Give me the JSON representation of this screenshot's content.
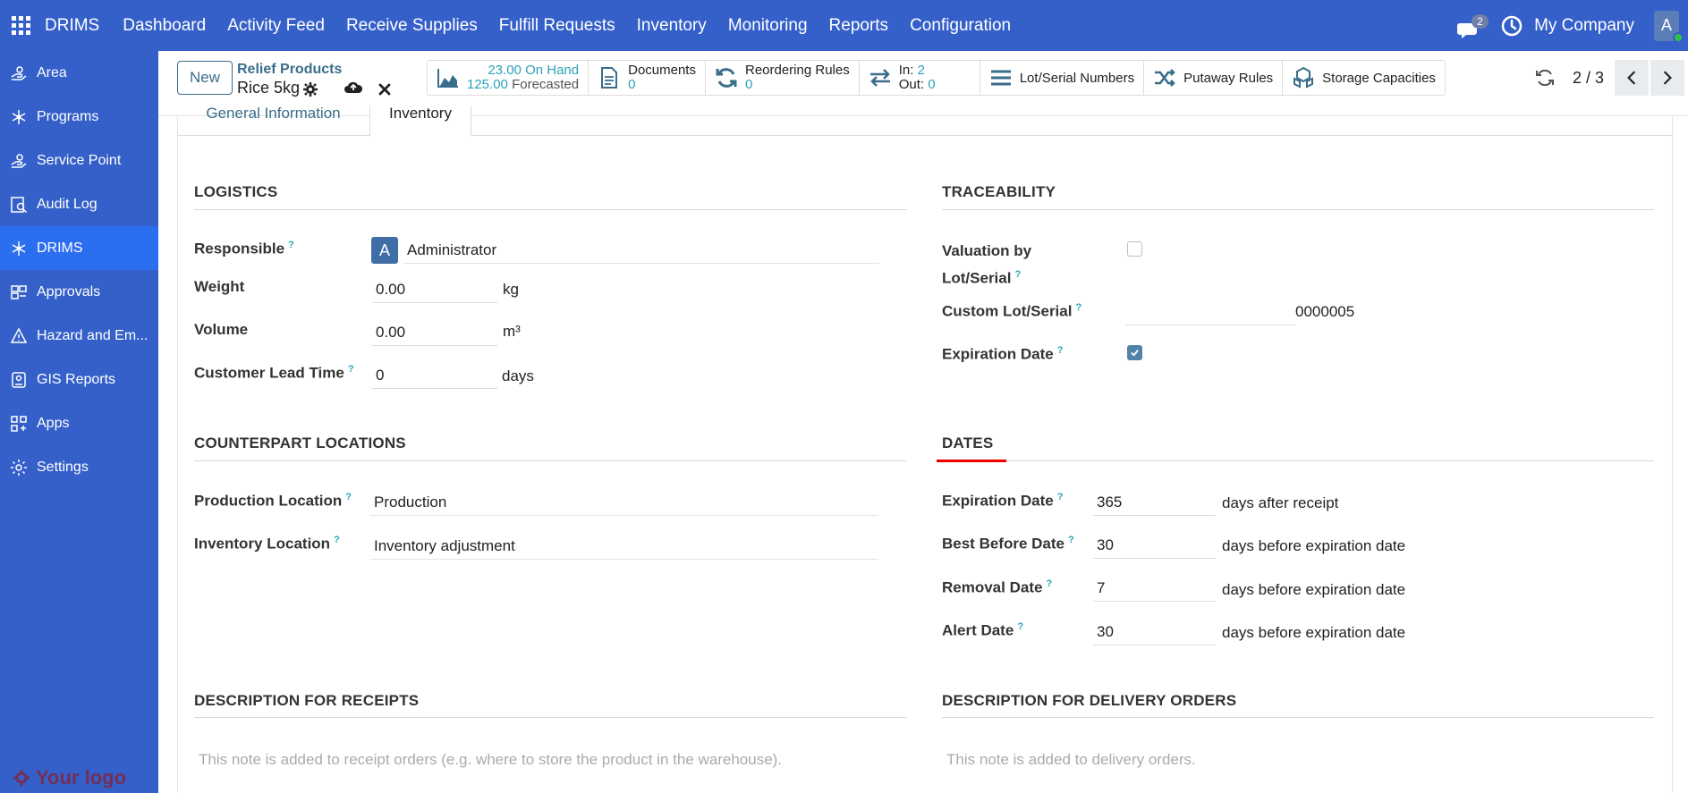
{
  "app": {
    "brand": "DRIMS",
    "menu": [
      "Dashboard",
      "Activity Feed",
      "Receive Supplies",
      "Fulfill Requests",
      "Inventory",
      "Monitoring",
      "Reports",
      "Configuration"
    ],
    "chat_count": "2",
    "company": "My Company",
    "user_initial": "A"
  },
  "sidebar": {
    "items": [
      {
        "label": "Area",
        "icon": "hand-icon"
      },
      {
        "label": "Programs",
        "icon": "network-icon"
      },
      {
        "label": "Service Point",
        "icon": "hand-icon"
      },
      {
        "label": "Audit Log",
        "icon": "audit-icon"
      },
      {
        "label": "DRIMS",
        "icon": "network-icon"
      },
      {
        "label": "Approvals",
        "icon": "approvals-icon"
      },
      {
        "label": "Hazard and Em...",
        "icon": "warning-icon"
      },
      {
        "label": "GIS Reports",
        "icon": "map-icon"
      },
      {
        "label": "Apps",
        "icon": "apps-icon"
      },
      {
        "label": "Settings",
        "icon": "gear-icon"
      }
    ],
    "active_index": 4,
    "logo_text": "Your logo"
  },
  "control": {
    "new_label": "New",
    "breadcrumb_parent": "Relief Products",
    "breadcrumb_current": "Rice 5kg",
    "smart": {
      "on_hand_value": "23.00",
      "on_hand_label": "On Hand",
      "forecast_value": "125.00",
      "forecast_label": "Forecasted",
      "documents_label": "Documents",
      "documents_count": "0",
      "reordering_label": "Reordering Rules",
      "reordering_count": "0",
      "in_label": "In:",
      "in_count": "2",
      "out_label": "Out:",
      "out_count": "0",
      "lot_label": "Lot/Serial Numbers",
      "putaway_label": "Putaway Rules",
      "storage_label": "Storage Capacities"
    },
    "pager": "2 / 3"
  },
  "tabs": {
    "general": "General Information",
    "inventory": "Inventory"
  },
  "logistics": {
    "title": "LOGISTICS",
    "responsible_label": "Responsible",
    "responsible_value": "Administrator",
    "responsible_initial": "A",
    "weight_label": "Weight",
    "weight_value": "0.00",
    "weight_unit": "kg",
    "volume_label": "Volume",
    "volume_value": "0.00",
    "volume_unit": "m³",
    "lead_label": "Customer Lead Time",
    "lead_value": "0",
    "lead_unit": "days"
  },
  "traceability": {
    "title": "TRACEABILITY",
    "valuation_label_1": "Valuation by",
    "valuation_label_2": "Lot/Serial",
    "valuation_checked": false,
    "custom_label": "Custom Lot/Serial",
    "custom_value": "0000005",
    "expiration_label": "Expiration Date",
    "expiration_checked": true
  },
  "counterpart": {
    "title": "COUNTERPART LOCATIONS",
    "production_label": "Production Location",
    "production_value": "Production",
    "inventory_label": "Inventory Location",
    "inventory_value": "Inventory adjustment"
  },
  "dates": {
    "title": "DATES",
    "expiration_label": "Expiration Date",
    "expiration_value": "365",
    "expiration_unit": "days after receipt",
    "best_label": "Best Before Date",
    "best_value": "30",
    "best_unit": "days before expiration date",
    "removal_label": "Removal Date",
    "removal_value": "7",
    "removal_unit": "days before expiration date",
    "alert_label": "Alert Date",
    "alert_value": "30",
    "alert_unit": "days before expiration date"
  },
  "descriptions": {
    "receipts_title": "DESCRIPTION FOR RECEIPTS",
    "receipts_placeholder": "This note is added to receipt orders (e.g. where to store the product in the warehouse).",
    "delivery_title": "DESCRIPTION FOR DELIVERY ORDERS",
    "delivery_placeholder": "This note is added to delivery orders."
  },
  "colors": {
    "primary": "#3560c9",
    "active": "#2b6ff0",
    "accent": "#2aa3b8",
    "link": "#3a6d8a"
  }
}
